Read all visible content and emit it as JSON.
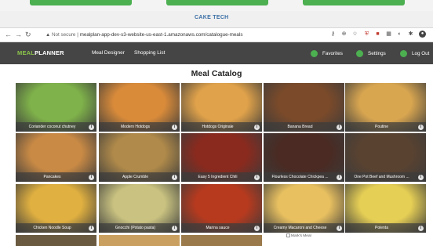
{
  "browser": {
    "security_label": "Not secure",
    "url": "mealplan-app-dev-s3-website-us-east-1.amazonaws.com/catalogue-meals"
  },
  "brand_bar": {
    "text": "CAKE TECH"
  },
  "app": {
    "logo_prefix": "MEAL",
    "logo_suffix": "PLANNER",
    "nav": {
      "meal_designer": "Meal Designer",
      "shopping_list": "Shopping List",
      "favorites": "Favorites",
      "settings": "Settings",
      "logout": "Log Out"
    }
  },
  "page_title": "Meal Catalog",
  "meals": [
    {
      "name": "Coriander coconut chutney",
      "color": "#7fb24a"
    },
    {
      "name": "Modern Hotdogs",
      "color": "#d98b3a"
    },
    {
      "name": "Hotdogs Originale",
      "color": "#e0a24a"
    },
    {
      "name": "Banana Bread",
      "color": "#7a4a2a"
    },
    {
      "name": "Poutine",
      "color": "#d9a650"
    },
    {
      "name": "Pancakes",
      "color": "#c98a45"
    },
    {
      "name": "Apple Crumble",
      "color": "#b08a4a"
    },
    {
      "name": "Easy 5 Ingredient Chili",
      "color": "#8a2a1e"
    },
    {
      "name": "Flourless Chocolate Chickpea ...",
      "color": "#4a2a22"
    },
    {
      "name": "One Pot Beef and Mushroom ...",
      "color": "#5a4230"
    },
    {
      "name": "Chicken Noodle Soup",
      "color": "#e0b040"
    },
    {
      "name": "Gnocchi (Potato pasta)",
      "color": "#c9c280"
    },
    {
      "name": "Marina sauce",
      "color": "#b83a1e"
    },
    {
      "name": "Creamy Macaroni and Cheese",
      "color": "#e8c060"
    },
    {
      "name": "Polenta",
      "color": "#e6cf55"
    }
  ],
  "broken_image": {
    "alt": "Mark's Meal"
  },
  "info_glyph": "i"
}
